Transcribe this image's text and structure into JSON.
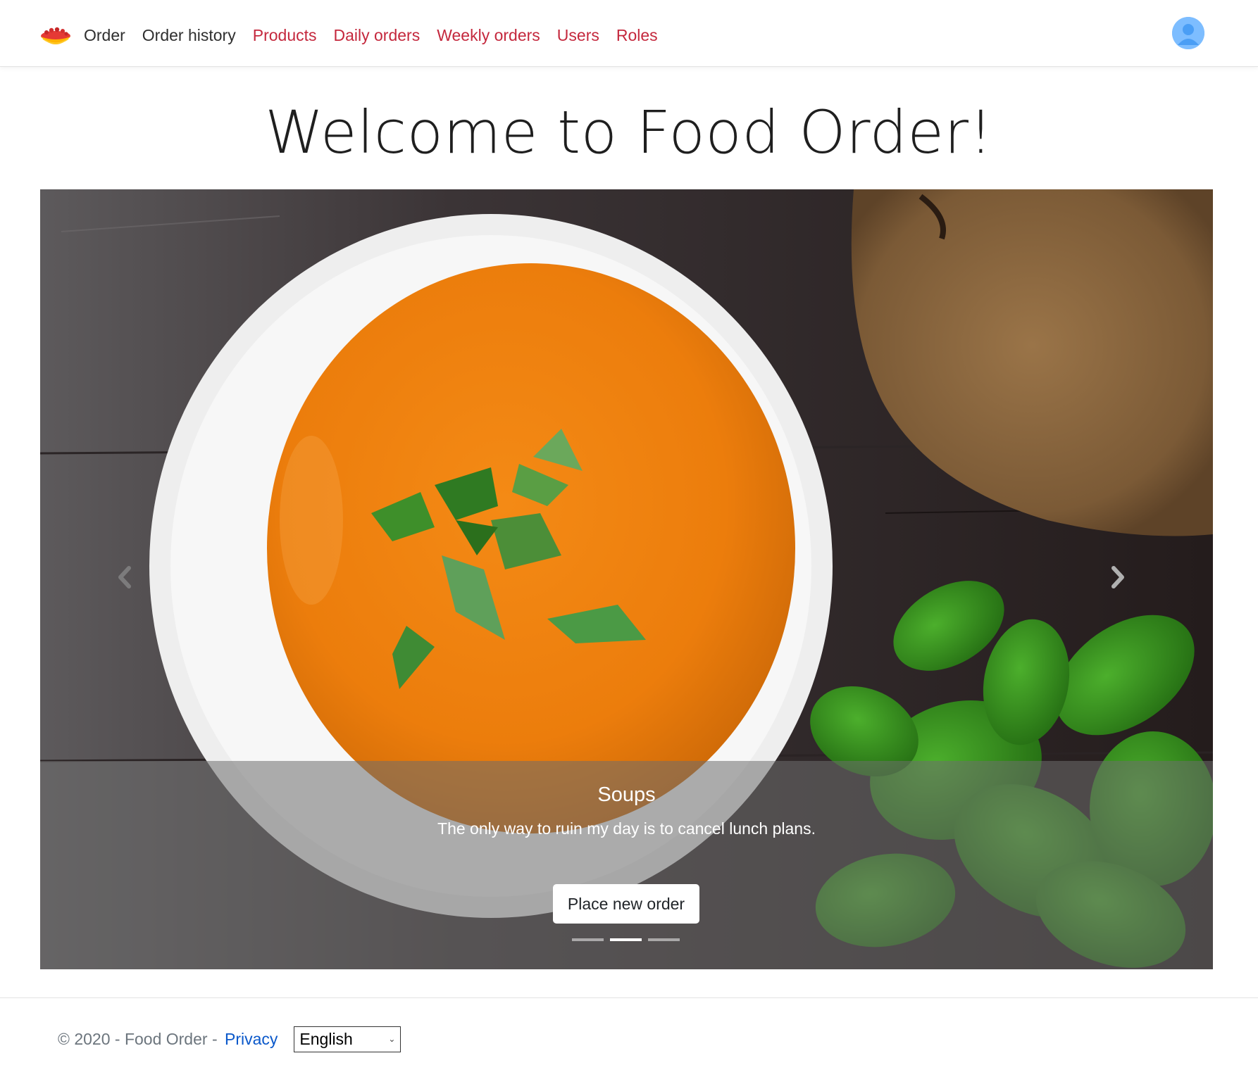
{
  "navbar": {
    "logo_icon": "food-bowl-logo-icon",
    "links": [
      {
        "label": "Order",
        "color": "dark"
      },
      {
        "label": "Order history",
        "color": "dark"
      },
      {
        "label": "Products",
        "color": "red"
      },
      {
        "label": "Daily orders",
        "color": "red"
      },
      {
        "label": "Weekly orders",
        "color": "red"
      },
      {
        "label": "Users",
        "color": "red"
      },
      {
        "label": "Roles",
        "color": "red"
      }
    ],
    "avatar_icon": "user-avatar-icon",
    "accent_color": "#c4283d"
  },
  "main": {
    "title": "Welcome to Food Order!"
  },
  "carousel": {
    "slide_title": "Soups",
    "slide_text": "The only way to ruin my day is to cancel lunch plans.",
    "button_label": "Place new order",
    "indicator_count": 3,
    "active_indicator": 1,
    "prev_icon": "chevron-left-icon",
    "next_icon": "chevron-right-icon"
  },
  "footer": {
    "copyright": "© 2020 - Food Order - ",
    "privacy_label": "Privacy",
    "language_selected": "English",
    "link_color": "#0a58ca"
  }
}
